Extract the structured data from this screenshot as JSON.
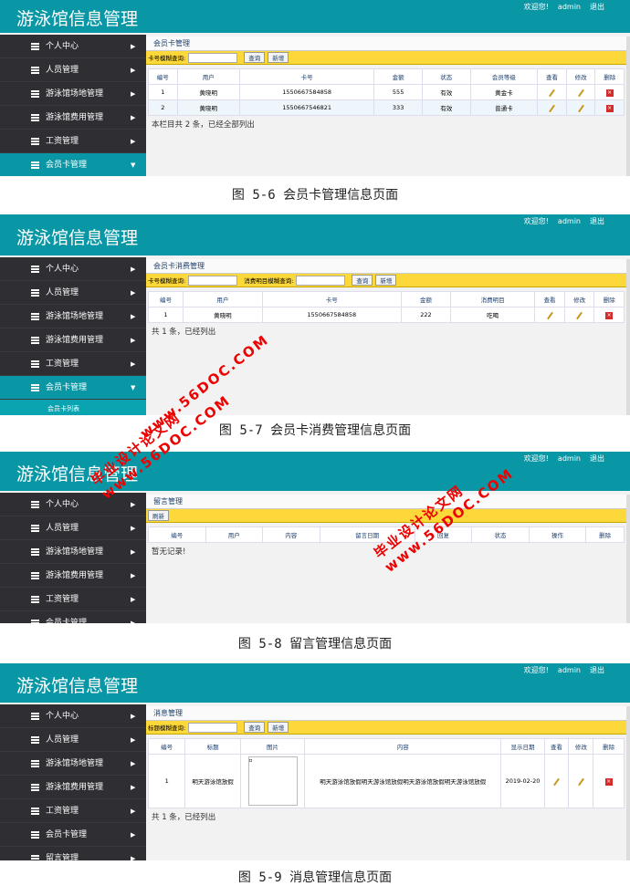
{
  "app_title": "游泳馆信息管理",
  "header_user": {
    "greeting": "欢迎您!",
    "username": "admin",
    "logout": "退出"
  },
  "colors": {
    "header": "#0a97a5",
    "sidebar": "#2e2e33",
    "toolbar": "#fdd83a",
    "delete": "#d42a2a"
  },
  "watermark": {
    "line1": "毕业设计论文网",
    "line2": "www.56DOC.COM"
  },
  "panels": [
    {
      "caption": "图 5-6 会员卡管理信息页面",
      "sidebar": [
        {
          "label": "个人中心"
        },
        {
          "label": "人员管理"
        },
        {
          "label": "游泳馆场地管理"
        },
        {
          "label": "游泳馆费用管理"
        },
        {
          "label": "工资管理"
        },
        {
          "label": "会员卡管理",
          "active": true
        }
      ],
      "content_title": "会员卡管理",
      "toolbar": {
        "fields": [
          "卡号模糊查询:"
        ],
        "buttons": [
          "查询",
          "新增"
        ]
      },
      "columns": [
        "编号",
        "用户",
        "卡号",
        "金额",
        "状态",
        "会员等级",
        "查看",
        "修改",
        "删除"
      ],
      "rows": [
        [
          "1",
          "黄晓明",
          "1550667584858",
          "555",
          "有效",
          "黄金卡"
        ],
        [
          "2",
          "黄晓明",
          "1550667546821",
          "333",
          "有效",
          "普通卡"
        ]
      ],
      "footer": "本栏目共 2 条，已经全部列出"
    },
    {
      "caption": "图 5-7 会员卡消费管理信息页面",
      "sidebar": [
        {
          "label": "个人中心"
        },
        {
          "label": "人员管理"
        },
        {
          "label": "游泳馆场地管理"
        },
        {
          "label": "游泳馆费用管理"
        },
        {
          "label": "工资管理"
        },
        {
          "label": "会员卡管理",
          "active": true,
          "submenu": [
            "会员卡列表"
          ]
        }
      ],
      "content_title": "会员卡消费管理",
      "toolbar": {
        "fields": [
          "卡号模糊查询:",
          "消费明目模糊查询:"
        ],
        "buttons": [
          "查询",
          "新增"
        ]
      },
      "columns": [
        "编号",
        "用户",
        "卡号",
        "金额",
        "消费明目",
        "查看",
        "修改",
        "删除"
      ],
      "rows": [
        [
          "1",
          "黄晓明",
          "1550667584858",
          "222",
          "吃喝"
        ]
      ],
      "footer": "共 1 条，已经列出"
    },
    {
      "caption": "图 5-8 留言管理信息页面",
      "sidebar": [
        {
          "label": "个人中心"
        },
        {
          "label": "人员管理"
        },
        {
          "label": "游泳馆场地管理"
        },
        {
          "label": "游泳馆费用管理"
        },
        {
          "label": "工资管理"
        },
        {
          "label": "会员卡管理"
        }
      ],
      "content_title": "留言管理",
      "toolbar": {
        "fields": [],
        "buttons": [
          "刷新"
        ]
      },
      "columns": [
        "编号",
        "用户",
        "内容",
        "留言日期",
        "回复",
        "状态",
        "操作",
        "删除"
      ],
      "rows": [],
      "footer": "暂无记录!"
    },
    {
      "caption": "图 5-9 消息管理信息页面",
      "sidebar": [
        {
          "label": "个人中心"
        },
        {
          "label": "人员管理"
        },
        {
          "label": "游泳馆场地管理"
        },
        {
          "label": "游泳馆费用管理"
        },
        {
          "label": "工资管理"
        },
        {
          "label": "会员卡管理"
        },
        {
          "label": "留言管理"
        }
      ],
      "content_title": "消息管理",
      "toolbar": {
        "fields": [
          "标题模糊查询:"
        ],
        "buttons": [
          "查询",
          "新增"
        ]
      },
      "columns": [
        "编号",
        "标题",
        "图片",
        "内容",
        "显示日期",
        "查看",
        "修改",
        "删除"
      ],
      "rows": [
        [
          "1",
          "明天游泳馆放假",
          "",
          "明天游泳馆放假明天游泳馆放假明天游泳馆放假明天游泳馆放假",
          "2019-02-20"
        ]
      ],
      "footer": "共 1 条，已经列出"
    }
  ]
}
